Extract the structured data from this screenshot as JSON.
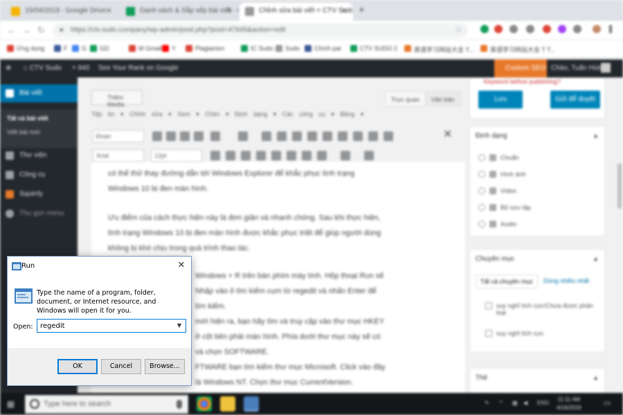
{
  "browser": {
    "tabs": [
      {
        "title": "15/04/2019 - Google Drive",
        "color": "#f4b400"
      },
      {
        "title": "Danh sách & Sắp xếp bài viết - CTV...",
        "color": "#0f9d58"
      },
      {
        "title": "Chỉnh sửa bài viết < CTV Sudo —",
        "color": "#999999"
      }
    ],
    "new_tab": "+",
    "url": "https://ctv.sudo.company/wp-admin/post.php?post=47645&action=edit",
    "bookmarks": [
      {
        "label": "Ứng dụng",
        "color": "#db4437"
      },
      {
        "label": "F",
        "color": "#3b5998"
      },
      {
        "label": "G",
        "color": "#4285f4"
      },
      {
        "label": "GD",
        "color": "#0f9d58"
      },
      {
        "label": "M Gmail",
        "color": "#db4437"
      },
      {
        "label": "Y",
        "color": "#ff0000"
      },
      {
        "label": "Plagiarism",
        "color": "#db4437"
      },
      {
        "label": "IC Sudo",
        "color": "#0f9d58"
      },
      {
        "label": "Sudo",
        "color": "#999999"
      },
      {
        "label": "Chính pai",
        "color": "#3b5998"
      },
      {
        "label": "CTV SUDO 2",
        "color": "#0f9d58"
      },
      {
        "label": "英语学习网站大全 T...",
        "color": "#e8792b"
      },
      {
        "label": "英语学习网站大全 T T...",
        "color": "#e8792b"
      }
    ]
  },
  "wp_admin_bar": {
    "site": "CTV Sudo",
    "counter": "940",
    "rank": "See Your Rank on Google",
    "seo_button": "Custom SEO",
    "user": "Chào, Tuấn Hùng"
  },
  "wp_sidebar": {
    "items": [
      {
        "label": "Bài viết",
        "active": true
      },
      {
        "label": "Thư viện",
        "active": false
      },
      {
        "label": "Công cụ",
        "active": false
      },
      {
        "label": "Squirrly",
        "active": false
      },
      {
        "label": "Thu gọn menu",
        "active": false
      }
    ],
    "sub": [
      "Tất cả bài viết",
      "Viết bài mới"
    ]
  },
  "editor": {
    "add_media": "Thêm Media",
    "tab_visual": "Trực quan",
    "tab_text": "Văn bản",
    "menus": "Tệp tin ▾   Chỉnh sửa ▾   Xem ▾   Chèn ▾   Định dạng ▾   Các công cụ ▾   Bảng ▾",
    "format_select": "Đoạn",
    "font_select": "Arial",
    "size_select": "12pt",
    "paragraphs": [
      "có thể thử thay đường dẫn tới Windows Explorer để khắc phục tình trạng",
      "Windows 10 bị đen màn hình.",
      "Ưu điểm của cách thực hiện này là đơn giản và nhanh chóng. Sau khi thực hiện,",
      "tình trạng Windows 10 bị đen màn hình được khắc phục triệt để giúp người dùng",
      "không bị khó chịu trong quá trình thao tác.",
      "Windows + R trên bàn phím máy tính. Hộp thoại Run sẽ",
      "Nhập vào ô tìm kiếm cụm từ regedit và nhấn Enter để",
      "tìm kiếm.",
      "mới hiện ra, bạn hãy tìm và truy cập vào thư mục HKEY",
      "ở cột bên phải màn hình. Phía dưới thư mục này sẽ có",
      "và chọn SOFTWARE.",
      "FTWARE bạn tìm kiếm thư mục Microsoft. Click vào đây",
      "là Windows NT. Chọn thư mục CurrentVersion."
    ]
  },
  "right_sidebar": {
    "publish_note": "Keyword before publishing?",
    "btn_save": "Lưu",
    "btn_publish": "Gửi để duyệt",
    "format_title": "Định dạng",
    "formats": [
      "Chuẩn",
      "Hình ảnh",
      "Video",
      "Bộ sưu tập",
      "Audio"
    ],
    "category_title": "Chuyên mục",
    "cat_tab_all": "Tất cả chuyên mục",
    "cat_tab_popular": "Dùng nhiều nhất",
    "categories": [
      "suy nghĩ tích cực/Chưa được phân loại",
      "suy nghĩ tích cực"
    ],
    "tags_title": "Thẻ"
  },
  "taskbar": {
    "search_placeholder": "Type here to search",
    "tray_lang": "ENG",
    "time": "11:11 AM",
    "date": "4/16/2019"
  },
  "run_dialog": {
    "title": "Run",
    "close": "✕",
    "description": "Type the name of a program, folder, document, or Internet resource, and Windows will open it for you.",
    "open_label": "Open:",
    "open_value": "regedit",
    "ok": "OK",
    "cancel": "Cancel",
    "browse": "Browse..."
  },
  "colors": {
    "wp_dark": "#23282d",
    "wp_blue": "#0073aa",
    "seo_orange": "#e8792b",
    "dialog_focus": "#0078d7"
  }
}
